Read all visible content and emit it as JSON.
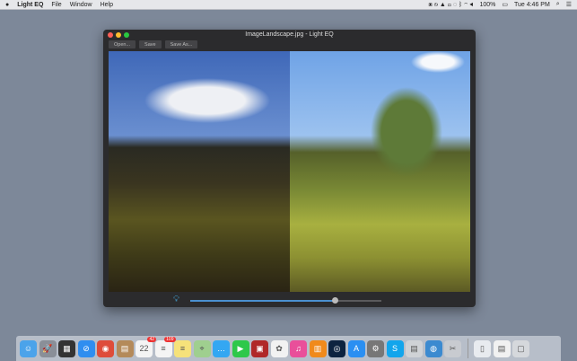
{
  "menubar": {
    "apple": "",
    "app": "Light EQ",
    "items": [
      "File",
      "Window",
      "Help"
    ],
    "status": [
      "100%",
      "Tue 4:46 PM"
    ]
  },
  "window": {
    "title": "ImageLandscape.jpg - Light EQ",
    "toolbar": {
      "open": "Open...",
      "save": "Save",
      "save_as": "Save As..."
    },
    "slider": {
      "value": 0.76
    }
  },
  "colors": {
    "accent": "#4a90d0",
    "close": "#fc5f57",
    "min": "#fdbc2e",
    "max": "#29c840"
  },
  "dock": {
    "apps": [
      {
        "name": "finder",
        "color": "#4ba3ea",
        "glyph": "☺"
      },
      {
        "name": "launchpad",
        "color": "#8a8f98",
        "glyph": "🚀"
      },
      {
        "name": "mission-control",
        "color": "#333",
        "glyph": "▦"
      },
      {
        "name": "safari",
        "color": "#2f8ef0",
        "glyph": "⊘"
      },
      {
        "name": "chrome",
        "color": "#de4c3a",
        "glyph": "◉"
      },
      {
        "name": "contacts",
        "color": "#b48a5a",
        "glyph": "▤"
      },
      {
        "name": "calendar",
        "color": "#f4f4f4",
        "glyph": "22",
        "badge": "42"
      },
      {
        "name": "reminders",
        "color": "#f4f4f4",
        "glyph": "≡",
        "badge": "109"
      },
      {
        "name": "notes",
        "color": "#f6e27a",
        "glyph": "≡"
      },
      {
        "name": "maps",
        "color": "#9fcf8f",
        "glyph": "⌖"
      },
      {
        "name": "messages",
        "color": "#34a7f2",
        "glyph": "…"
      },
      {
        "name": "facetime",
        "color": "#2ec84a",
        "glyph": "▶"
      },
      {
        "name": "photo-booth",
        "color": "#b02828",
        "glyph": "▣"
      },
      {
        "name": "photos",
        "color": "#f2f2f2",
        "glyph": "✿"
      },
      {
        "name": "itunes",
        "color": "#e94f9a",
        "glyph": "♫"
      },
      {
        "name": "ibooks",
        "color": "#f08a1c",
        "glyph": "▥"
      },
      {
        "name": "light-eq",
        "color": "#0d2340",
        "glyph": "◎"
      },
      {
        "name": "app-store",
        "color": "#2a8ff2",
        "glyph": "A"
      },
      {
        "name": "system-preferences",
        "color": "#777",
        "glyph": "⚙"
      },
      {
        "name": "skype",
        "color": "#12a5ec",
        "glyph": "S"
      },
      {
        "name": "preview-printer",
        "color": "#cfd2d6",
        "glyph": "▤"
      },
      {
        "name": "network",
        "color": "#3b8ad0",
        "glyph": "◍"
      },
      {
        "name": "utilities",
        "color": "#c8cbd0",
        "glyph": "✂"
      }
    ],
    "stack": [
      {
        "name": "downloads",
        "color": "#e8ebef",
        "glyph": "▯"
      },
      {
        "name": "documents",
        "color": "#f1f1f1",
        "glyph": "▤"
      },
      {
        "name": "trash",
        "color": "#d5d8dc",
        "glyph": "▢"
      }
    ]
  }
}
